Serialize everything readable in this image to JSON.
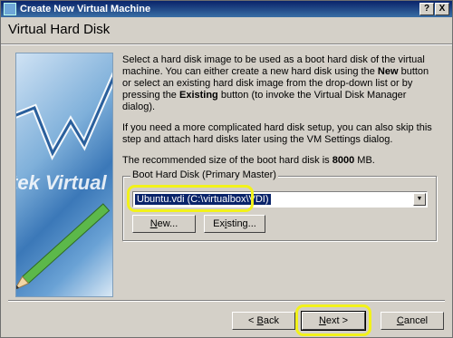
{
  "window": {
    "title": "Create New Virtual Machine",
    "help_btn": "?",
    "close_btn": "X"
  },
  "header": {
    "title": "Virtual Hard Disk"
  },
  "side_image": {
    "text": "tek Virtual"
  },
  "description": {
    "p1_a": "Select a hard disk image to be used as a boot hard disk of the virtual machine. You can either create a new hard disk using the ",
    "p1_new": "New",
    "p1_b": " button or select an existing hard disk image from the drop-down list or by pressing the ",
    "p1_existing": "Existing",
    "p1_c": " button (to invoke the Virtual Disk Manager dialog).",
    "p2": "If you need a more complicated hard disk setup, you can also skip this step and attach hard disks later using the VM Settings dialog.",
    "p3_a": "The recommended size of the boot hard disk is ",
    "p3_size": "8000",
    "p3_b": " MB."
  },
  "boot_disk": {
    "label": "Boot Hard Disk (Primary Master)",
    "selected": "Ubuntu.vdi (C:\\virtualbox\\VDI)",
    "new_first": "N",
    "new_rest": "ew...",
    "existing_first": "Ex",
    "existing_u": "i",
    "existing_rest": "sting..."
  },
  "footer": {
    "back_arrow": "< ",
    "back_u": "B",
    "back_rest": "ack",
    "next_u": "N",
    "next_rest": "ext >",
    "cancel_u": "C",
    "cancel_rest": "ancel"
  },
  "highlight_color": "#f2f21a"
}
